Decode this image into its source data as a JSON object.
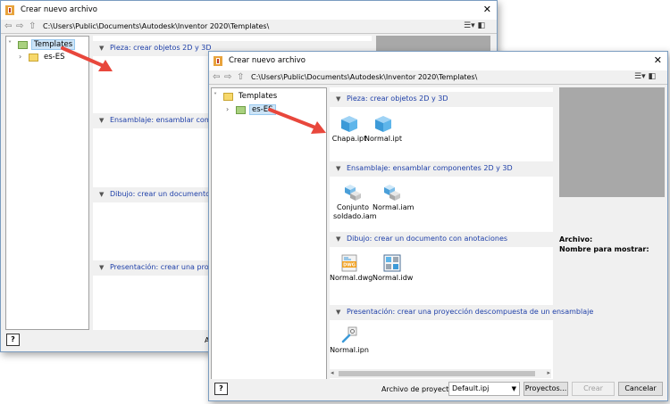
{
  "back_window": {
    "title": "Crear nuevo archivo",
    "path": "C:\\Users\\Public\\Documents\\Autodesk\\Inventor 2020\\Templates\\",
    "tree": [
      {
        "label": "Templates",
        "selected": true
      },
      {
        "label": "es-ES",
        "selected": false
      }
    ],
    "sections": [
      {
        "title": "Pieza: crear objetos 2D y 3D"
      },
      {
        "title": "Ensamblaje: ensamblar componente"
      },
      {
        "title": "Dibujo: crear un documento con a"
      },
      {
        "title": "Presentación: crear una proyecció"
      }
    ],
    "help_label": "?",
    "partial_label": "A"
  },
  "front_window": {
    "title": "Crear nuevo archivo",
    "path": "C:\\Users\\Public\\Documents\\Autodesk\\Inventor 2020\\Templates\\",
    "tree": [
      {
        "label": "Templates",
        "selected": false
      },
      {
        "label": "es-ES",
        "selected": true
      }
    ],
    "sections": [
      {
        "title": "Pieza: crear objetos 2D y 3D",
        "files": [
          {
            "name": "Chapa.ipt",
            "icon": "part-cube-icon"
          },
          {
            "name": "Normal.ipt",
            "icon": "part-cube-icon"
          }
        ]
      },
      {
        "title": "Ensamblaje: ensamblar componentes 2D y 3D",
        "files": [
          {
            "name": "Conjunto soldado.iam",
            "icon": "assembly-icon"
          },
          {
            "name": "Normal.iam",
            "icon": "assembly-icon"
          }
        ]
      },
      {
        "title": "Dibujo: crear un documento con anotaciones",
        "files": [
          {
            "name": "Normal.dwg",
            "icon": "dwg-drawing-icon"
          },
          {
            "name": "Normal.idw",
            "icon": "idw-drawing-icon"
          }
        ]
      },
      {
        "title": "Presentación: crear una proyección descompuesta de un ensamblaje",
        "files": [
          {
            "name": "Normal.ipn",
            "icon": "presentation-icon"
          }
        ]
      }
    ],
    "info_archivo": "Archivo:",
    "info_nombre": "Nombre para mostrar:",
    "project_label": "Archivo de proyecto:",
    "project_value": "Default.ipj",
    "projects_button": "Proyectos...",
    "create_button": "Crear",
    "cancel_button": "Cancelar",
    "help_label": "?",
    "dwg_badge": "DWG"
  },
  "colors": {
    "accent_arrow": "#e8473c",
    "section_title": "#1e3fa8",
    "preview_gray": "#a8a8a8"
  }
}
